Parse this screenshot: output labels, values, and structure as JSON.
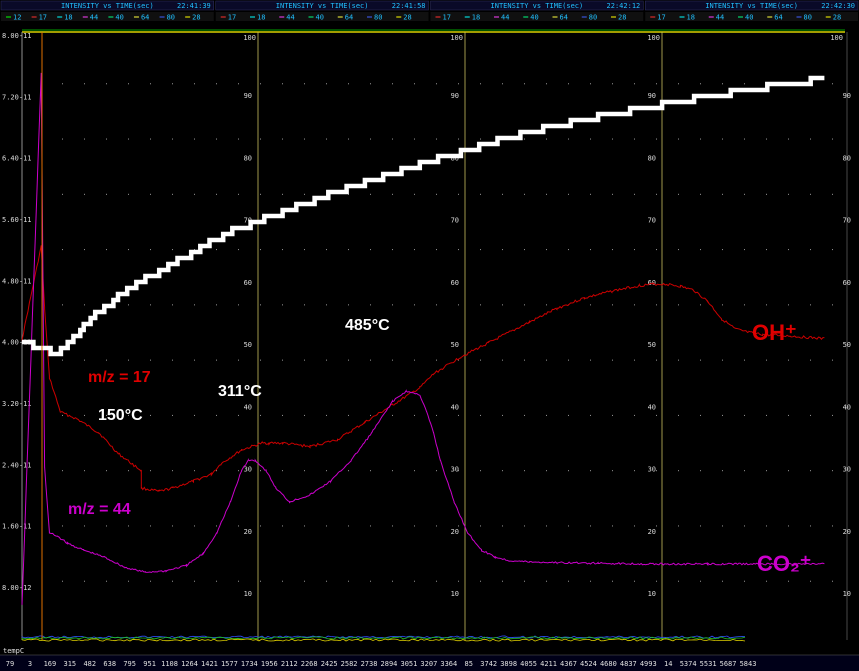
{
  "header": {
    "panels": [
      {
        "title": "INTENSITY vs TIME(sec)",
        "time": "22:41:39",
        "legend": [
          "12",
          "17",
          "18",
          "44",
          "40",
          "64",
          "80",
          "28"
        ]
      },
      {
        "title": "INTENSITY vs TIME(sec)",
        "time": "22:41:58",
        "legend": [
          "17",
          "18",
          "44",
          "40",
          "64",
          "80",
          "28"
        ]
      },
      {
        "title": "INTENSITY vs TIME(sec)",
        "time": "22:42:12",
        "legend": [
          "17",
          "18",
          "44",
          "40",
          "64",
          "80",
          "28"
        ]
      },
      {
        "title": "INTENSITY vs TIME(sec)",
        "time": "22:42:30",
        "legend": [
          "17",
          "18",
          "44",
          "40",
          "64",
          "80",
          "28"
        ]
      }
    ],
    "legend_colors": {
      "12": "#00ff00",
      "17": "#ff3030",
      "18": "#00ffff",
      "44": "#ff40ff",
      "40": "#00ff80",
      "64": "#ffff40",
      "80": "#4060ff",
      "28": "#ffff00"
    }
  },
  "chart_data": {
    "type": "line",
    "xlabel": "",
    "ylabel": "",
    "y_left_ticks": [
      "8.00-11",
      "7.20-11",
      "6.40-11",
      "5.60-11",
      "4.80-11",
      "4.00-11",
      "3.20-11",
      "2.40-11",
      "1.60-11",
      "8.00-12"
    ],
    "y_right_ticks": [
      "90",
      "80",
      "70",
      "60",
      "50",
      "40",
      "30",
      "20",
      "10"
    ],
    "panel_top_labels": [
      "100",
      "100",
      "100",
      "100"
    ],
    "x_tick_labels": [
      "79",
      "3",
      "169",
      "315",
      "482",
      "638",
      "795",
      "951",
      "1108",
      "1264",
      "1421",
      "1577",
      "1734",
      "1956",
      "2112",
      "2268",
      "2425",
      "2582",
      "2738",
      "2894",
      "3051",
      "3207",
      "3364",
      "85",
      "3742",
      "3898",
      "4055",
      "4211",
      "4367",
      "4524",
      "4680",
      "4837",
      "4993",
      "14",
      "5374",
      "5531",
      "5687",
      "5843"
    ],
    "xlim": [
      0,
      6000
    ],
    "ylim_left": [
      0,
      8.8e-11
    ],
    "ylim_right": [
      0,
      100
    ],
    "grid": true,
    "series": [
      {
        "name": "m/z = 17",
        "color": "#cc0000",
        "x": [
          0,
          140,
          165,
          200,
          280,
          400,
          560,
          700,
          870,
          870,
          1000,
          1100,
          1250,
          1380,
          1450,
          1600,
          1750,
          1800,
          1900,
          2100,
          2300,
          2500,
          2700,
          2900,
          3000,
          3200,
          3400,
          3500,
          3700,
          3900,
          4100,
          4300,
          4500,
          4600,
          4700,
          4800,
          4900,
          5000,
          5100,
          5200,
          5300,
          5400,
          5600,
          5850
        ],
        "y": [
          4.35e-11,
          5.7e-11,
          4.8e-11,
          3.8e-11,
          3.3e-11,
          3.2e-11,
          3e-11,
          2.7e-11,
          2.45e-11,
          2.2e-11,
          2.15e-11,
          2.2e-11,
          2.3e-11,
          2.4e-11,
          2.55e-11,
          2.75e-11,
          2.85e-11,
          2.85e-11,
          2.85e-11,
          2.8e-11,
          2.9e-11,
          3.15e-11,
          3.4e-11,
          3.65e-11,
          3.85e-11,
          4.1e-11,
          4.3e-11,
          4.4e-11,
          4.6e-11,
          4.8e-11,
          4.95e-11,
          5.05e-11,
          5.13e-11,
          5.15e-11,
          5.15e-11,
          5.12e-11,
          5.06e-11,
          4.9e-11,
          4.65e-11,
          4.5e-11,
          4.45e-11,
          4.42e-11,
          4.4e-11,
          4.36e-11
        ]
      },
      {
        "name": "m/z = 44",
        "color": "#cc00cc",
        "x": [
          0,
          140,
          165,
          200,
          260,
          330,
          450,
          600,
          750,
          900,
          1050,
          1200,
          1320,
          1420,
          1520,
          1600,
          1650,
          1700,
          1780,
          1850,
          1950,
          2100,
          2250,
          2400,
          2550,
          2700,
          2800,
          2900,
          2950,
          3000,
          3050,
          3150,
          3250,
          3350,
          3450,
          3550,
          3700,
          3900,
          4200,
          4600,
          5000,
          5400,
          5850
        ],
        "y": [
          5e-12,
          8.2e-11,
          2.5e-11,
          1.55e-11,
          1.5e-11,
          1.4e-11,
          1.3e-11,
          1.2e-11,
          1.05e-11,
          9.8e-12,
          1e-11,
          1.08e-11,
          1.25e-11,
          1.55e-11,
          2e-11,
          2.45e-11,
          2.6e-11,
          2.6e-11,
          2.45e-11,
          2.2e-11,
          2e-11,
          2.1e-11,
          2.3e-11,
          2.6e-11,
          3e-11,
          3.45e-11,
          3.6e-11,
          3.55e-11,
          3.3e-11,
          3e-11,
          2.6e-11,
          2e-11,
          1.55e-11,
          1.3e-11,
          1.2e-11,
          1.15e-11,
          1.13e-11,
          1.12e-11,
          1.11e-11,
          1.1e-11,
          1.1e-11,
          1.1e-11,
          1.1e-11
        ]
      },
      {
        "name": "temperature",
        "color": "#ffffff",
        "axis": "right",
        "x": [
          0,
          250,
          350,
          500,
          700,
          900,
          1100,
          1300,
          1500,
          1700,
          1900,
          2100,
          2300,
          2500,
          2700,
          2900,
          3100,
          3300,
          3500,
          3700,
          3900,
          4100,
          4300,
          4500,
          4700,
          4900,
          5100,
          5300,
          5500,
          5700,
          5850
        ],
        "y": [
          49,
          47,
          49,
          53,
          56.5,
          59.5,
          62,
          64.5,
          67,
          68.8,
          70.5,
          72.2,
          73.8,
          75.3,
          76.8,
          78.2,
          79.6,
          81,
          82.3,
          83.5,
          84.6,
          85.7,
          86.6,
          87.4,
          88.2,
          89,
          89.8,
          90.5,
          91.2,
          91.8,
          92.3
        ]
      }
    ],
    "annotations": [
      {
        "text": "150°C",
        "color": "#ffffff",
        "size": "large"
      },
      {
        "text": "311°C",
        "color": "#ffffff",
        "size": "large"
      },
      {
        "text": "485°C",
        "color": "#ffffff",
        "size": "large"
      },
      {
        "text": "m/z = 17",
        "color": "#e00000",
        "size": "large"
      },
      {
        "text": "m/z = 44",
        "color": "#cc00cc",
        "size": "large"
      },
      {
        "text": "OH⁺",
        "color": "#e00000",
        "size": "xlarge"
      },
      {
        "text": "CO₂⁺",
        "color": "#cc00cc",
        "size": "xlarge"
      }
    ],
    "bottom_corner_label": "tempC"
  }
}
